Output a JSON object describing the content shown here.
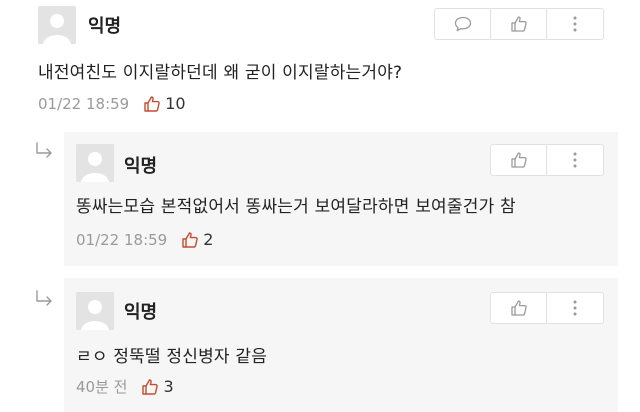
{
  "post": {
    "author": "익명",
    "text": "내전여친도 이지랄하던데 왜 굳이 이지랄하는거야?",
    "timestamp": "01/22 18:59",
    "likes": "10",
    "accent_color": "#c34d2d"
  },
  "replies": [
    {
      "author": "익명",
      "text": "똥싸는모습 본적없어서 똥싸는거 보여달라하면 보여줄건가 참",
      "timestamp": "01/22 18:59",
      "likes": "2"
    },
    {
      "author": "익명",
      "text": "ㄹㅇ 정뚝떨 정신병자 같음",
      "timestamp": "40분 전",
      "likes": "3"
    }
  ],
  "icons": {
    "comment": "comment-icon",
    "like": "thumbs-up-icon",
    "more": "more-vertical-icon",
    "reply": "reply-arrow-icon",
    "avatar": "avatar-placeholder-icon"
  }
}
